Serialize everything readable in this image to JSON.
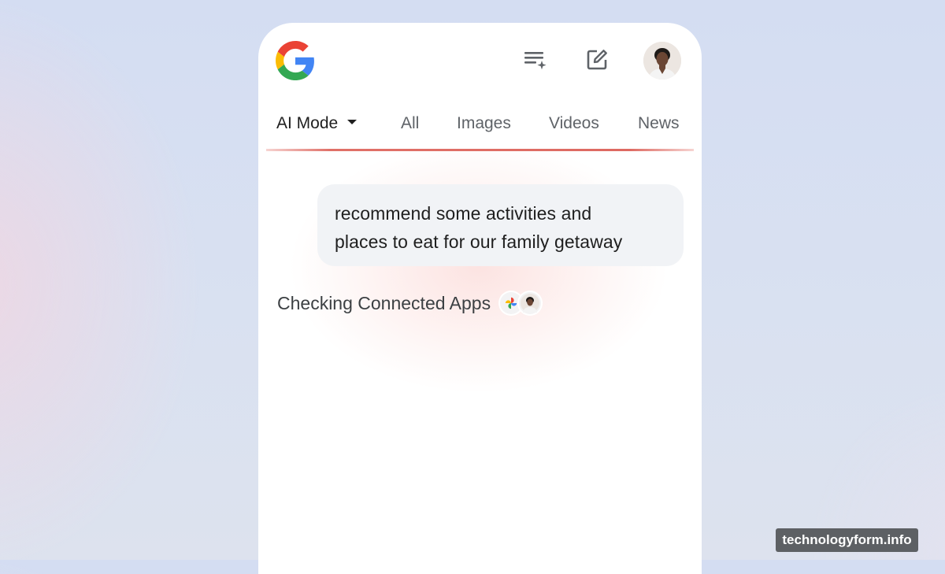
{
  "header": {
    "logo_icon": "google-g-logo",
    "icons": [
      "ai-history-icon",
      "edit-icon"
    ],
    "avatar": "profile-avatar"
  },
  "tabs": [
    {
      "label": "AI Mode",
      "active": true,
      "has_dropdown": true
    },
    {
      "label": "All"
    },
    {
      "label": "Images"
    },
    {
      "label": "Videos"
    },
    {
      "label": "News"
    }
  ],
  "chat": {
    "query_line1": "recommend some activities and",
    "query_line2": "places to eat for our family getaway",
    "status": "Checking Connected Apps",
    "status_icons": [
      "google-photos-icon",
      "user-avatar-icon"
    ]
  },
  "colors": {
    "accent_line": "#e07068",
    "bubble_bg": "#f1f3f6"
  },
  "watermark": "technologyform.info"
}
